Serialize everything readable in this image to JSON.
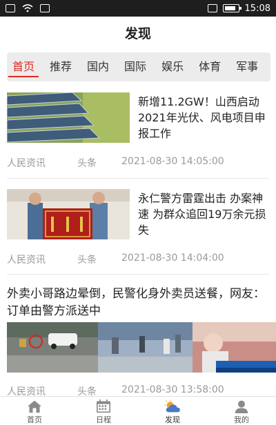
{
  "status": {
    "time": "15:08"
  },
  "header": {
    "title": "发现"
  },
  "tabs": [
    {
      "label": "首页",
      "active": true
    },
    {
      "label": "推荐"
    },
    {
      "label": "国内"
    },
    {
      "label": "国际"
    },
    {
      "label": "娱乐"
    },
    {
      "label": "体育"
    },
    {
      "label": "军事"
    }
  ],
  "articles": [
    {
      "title": "新增11.2GW！山西启动2021年光伏、风电项目申报工作",
      "source": "人民资讯",
      "category": "头条",
      "time": "2021-08-30 14:05:00",
      "image": "solar-panels-photo"
    },
    {
      "title": "永仁警方雷霆出击 办案神速 为群众追回19万余元损失",
      "source": "人民资讯",
      "category": "头条",
      "time": "2021-08-30 14:04:00",
      "image": "police-banner-photo"
    },
    {
      "title": "外卖小哥路边晕倒，民警化身外卖员送餐，网友：订单由警方派送中",
      "source": "人民资讯",
      "category": "头条",
      "time": "2021-08-30 13:58:00",
      "image": "street-cctv-photos"
    }
  ],
  "bottom_nav": [
    {
      "label": "首页",
      "icon": "home-icon"
    },
    {
      "label": "日程",
      "icon": "calendar-icon"
    },
    {
      "label": "发现",
      "icon": "discover-icon",
      "active": true
    },
    {
      "label": "我的",
      "icon": "profile-icon"
    }
  ],
  "colors": {
    "accent": "#e0281f",
    "tabbar_bg": "#ececec",
    "meta": "#999999"
  }
}
